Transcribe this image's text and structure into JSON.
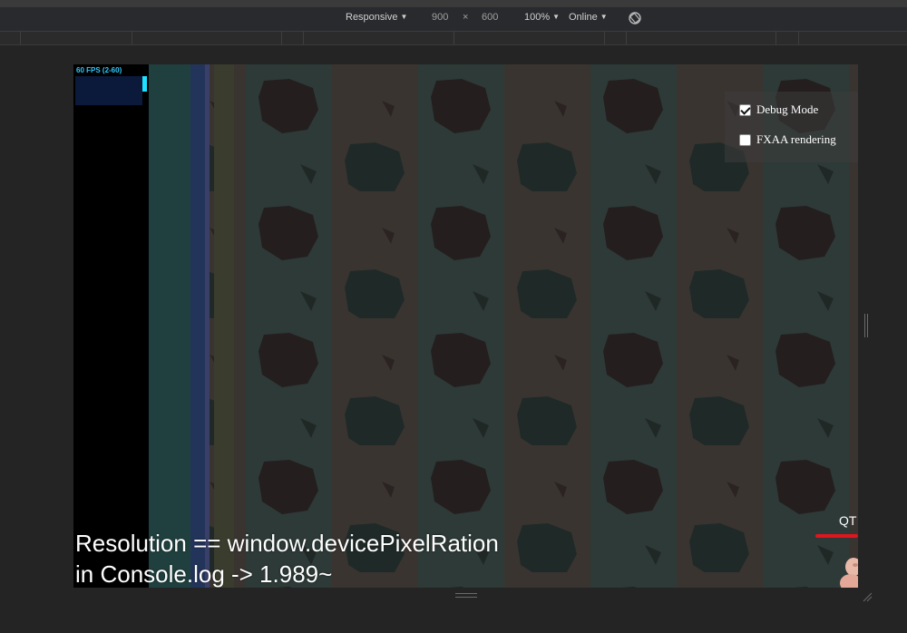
{
  "toolbar": {
    "device": "Responsive",
    "width": "900",
    "times": "×",
    "height": "600",
    "zoom": "100%",
    "network": "Online"
  },
  "game": {
    "fps_label": "60 FPS (2-60)",
    "fps_current": 60,
    "fps_range": [
      2,
      60
    ]
  },
  "options": {
    "debug_label": "Debug Mode",
    "debug_checked": true,
    "fxaa_label": "FXAA rendering",
    "fxaa_checked": false
  },
  "widget": {
    "qt_label": "QT"
  },
  "caption": {
    "line1": "Resolution == window.devicePixelRation",
    "line2": "in Console.log -> 1.989~"
  },
  "colors": {
    "accent_red": "#e0151d",
    "fps_cyan": "#1fe0ff"
  }
}
